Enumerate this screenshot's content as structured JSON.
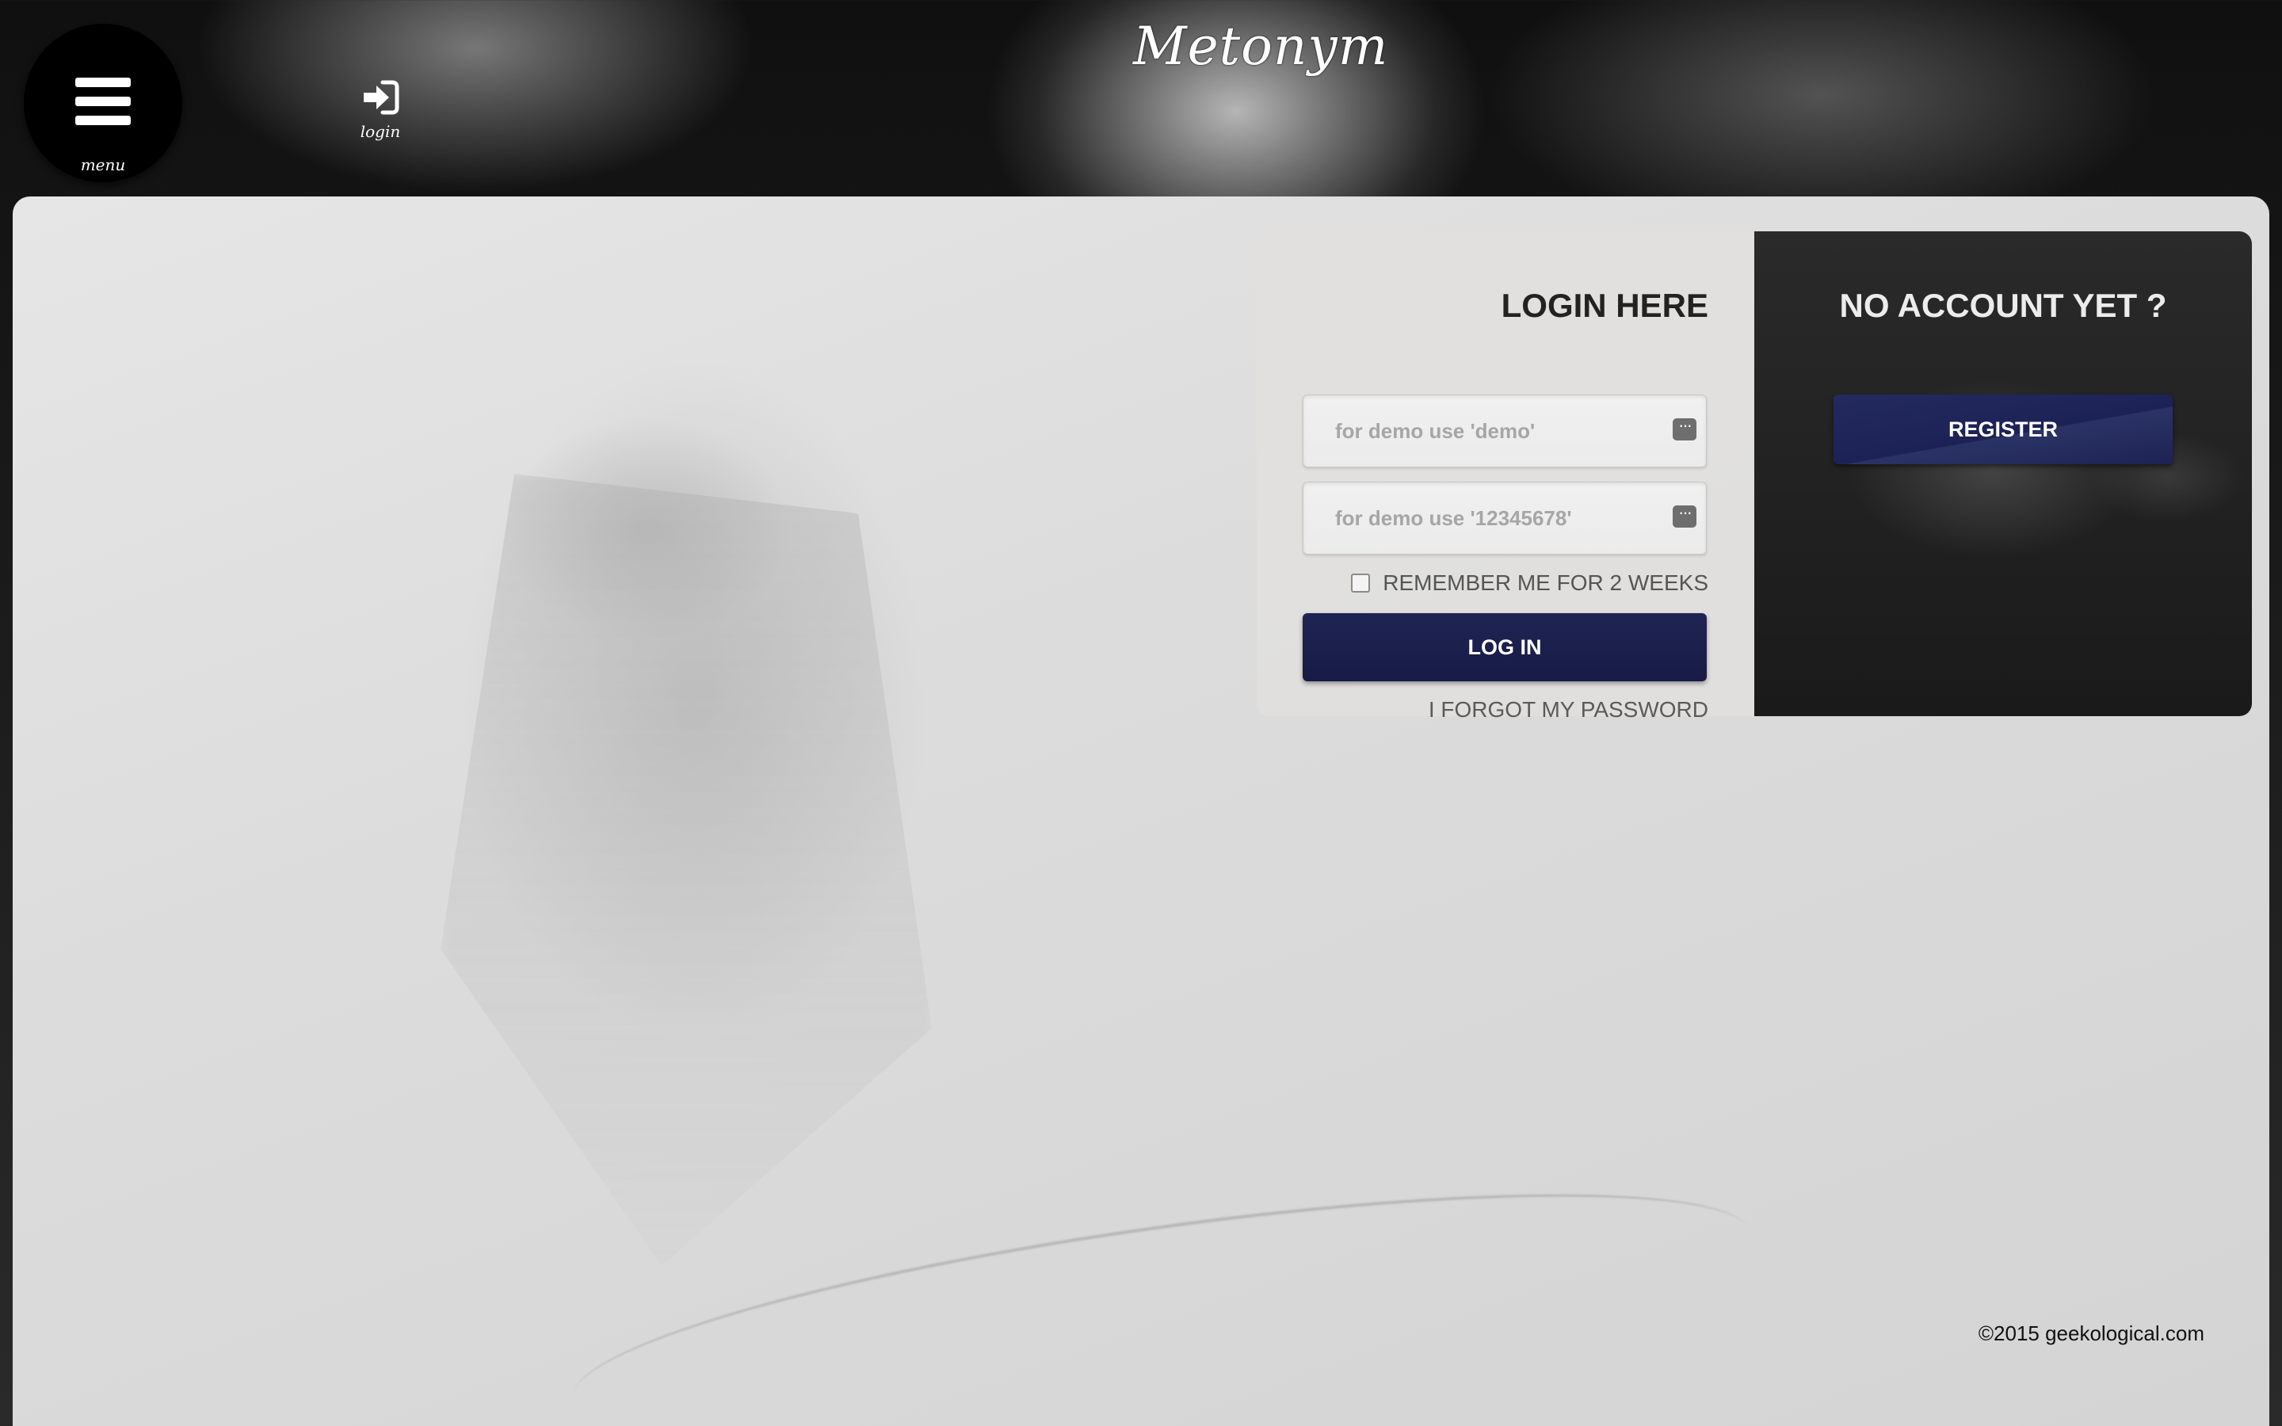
{
  "header": {
    "menu_label": "menu",
    "login_label": "login",
    "logo_text": "Metonym"
  },
  "login": {
    "title": "LOGIN HERE",
    "username_placeholder": "for demo use 'demo'",
    "password_placeholder": "for demo use '12345678'",
    "remember_label": "REMEMBER ME FOR 2 WEEKS",
    "remember_checked": false,
    "submit_label": "LOG IN",
    "forgot_label": "I FORGOT MY PASSWORD"
  },
  "register": {
    "title": "NO ACCOUNT YET ?",
    "button_label": "REGISTER"
  },
  "footer": {
    "copyright": "©2015 geekological.com"
  },
  "colors": {
    "button_navy": "#1f2453",
    "register_panel": "#222222",
    "login_panel": "#e1e0de"
  }
}
